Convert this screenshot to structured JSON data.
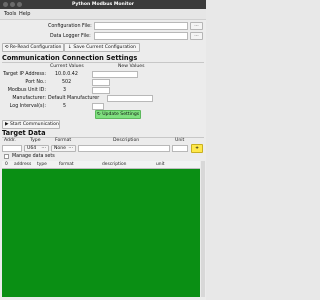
{
  "window": {
    "title": "Python Modbus Monitor"
  },
  "menu": [
    "Tools",
    "Help"
  ],
  "config": {
    "config_file_label": "Configuration File:",
    "config_file_value": "",
    "logger_file_label": "Data Logger File:",
    "logger_file_value": "",
    "browse_label": "...",
    "reread_button": "Re-Read Configuration",
    "save_button": "Save Current Configuration"
  },
  "conn": {
    "title": "Communication Connection Settings",
    "current_header": "Current Values",
    "new_header": "New Values",
    "fields": [
      {
        "label": "Target IP Address:",
        "current": "10.0.0.42"
      },
      {
        "label": "Port No.:",
        "current": "502"
      },
      {
        "label": "Modbus Unit ID:",
        "current": "3"
      },
      {
        "label": "Manufacturer:",
        "current": "Default Manufacturer"
      },
      {
        "label": "Log Interval(s):",
        "current": "5"
      }
    ],
    "update_button": "Update Settings",
    "start_button": "Start Communication"
  },
  "target": {
    "title": "Target Data",
    "headers": [
      "Addr.",
      "Type",
      "Format",
      "Description",
      "Unit"
    ],
    "type_value": "U64",
    "format_value": "None",
    "add_button": "+",
    "manage_label": "Manage data sets",
    "grid_headers": [
      "0",
      "address",
      "type",
      "format",
      "description",
      "unit"
    ]
  },
  "colors": {
    "grid_bg": "#0a8f14",
    "update_btn": "#7fe07f",
    "titlebar": "#3b3b3b"
  }
}
